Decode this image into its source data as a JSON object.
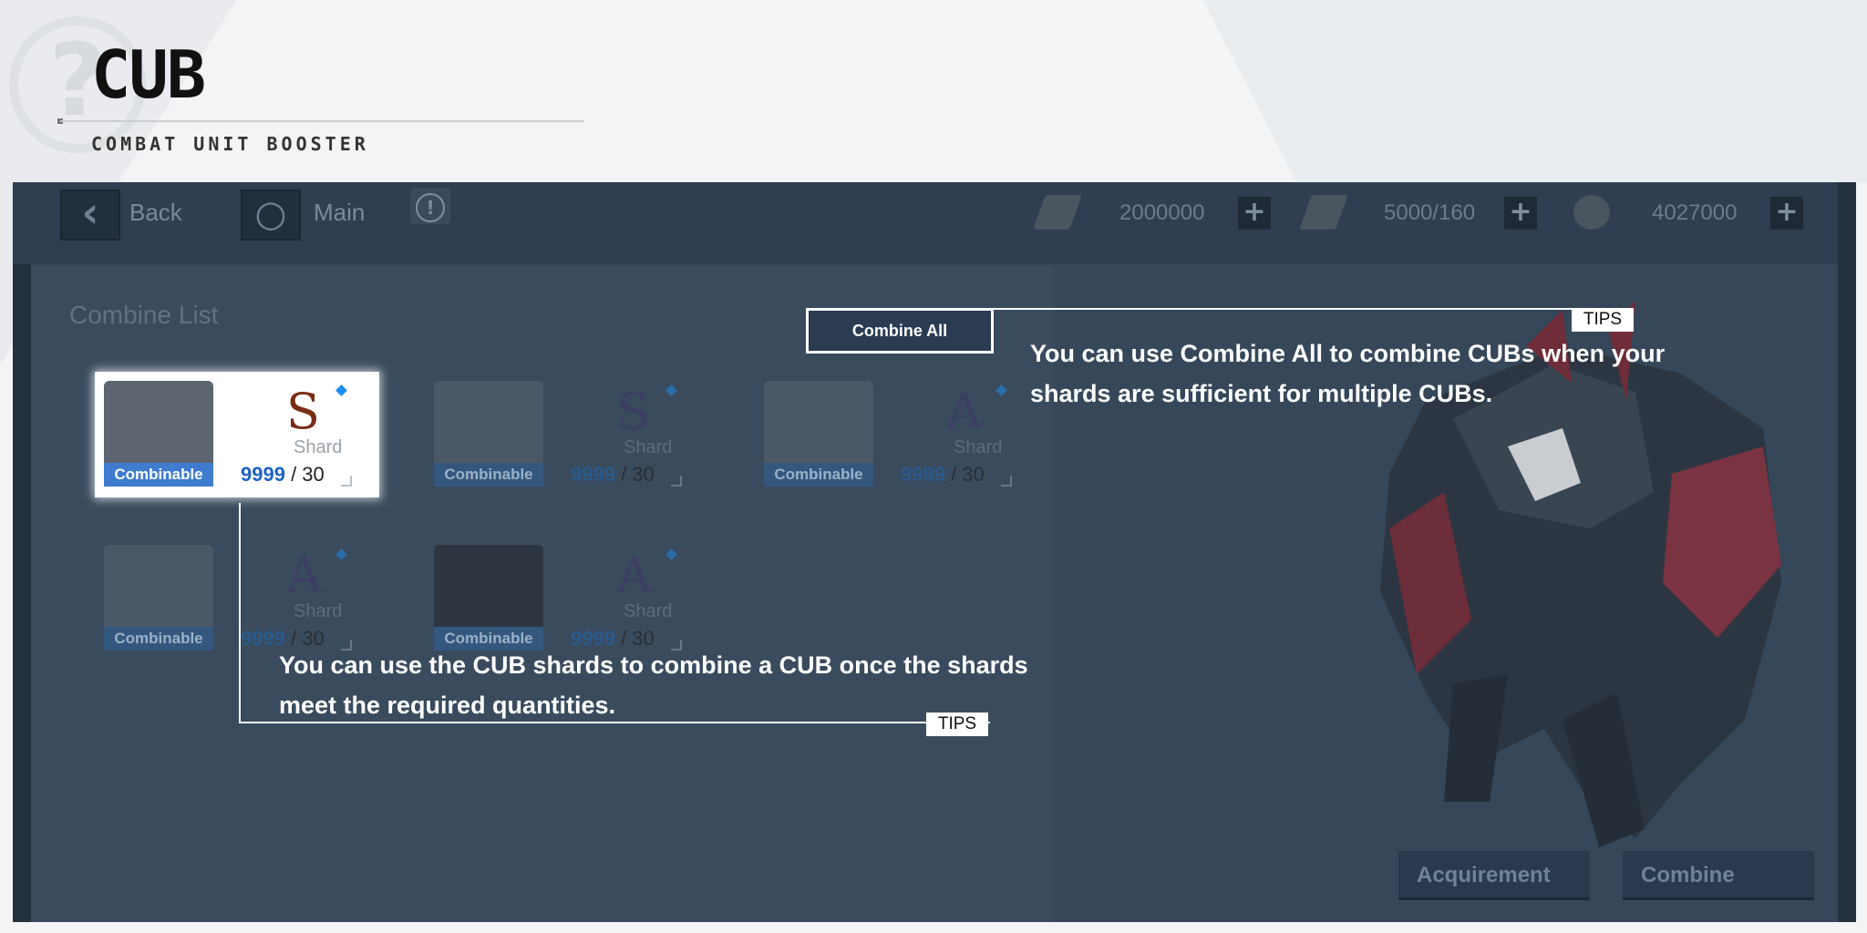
{
  "page": {
    "title": "CUB",
    "subtitle": "COMBAT UNIT BOOSTER",
    "watermark": "?"
  },
  "topbar": {
    "back_label": "Back",
    "main_label": "Main",
    "back_icon": "‹",
    "main_icon": "○",
    "info_icon": "!",
    "resources": [
      {
        "icon": "gold-icon",
        "value": "2000000"
      },
      {
        "icon": "stamina-icon",
        "value": "5000/160"
      },
      {
        "icon": "gear-coin-icon",
        "value": "4027000"
      }
    ],
    "plus": "+"
  },
  "combine_list": {
    "title": "Combine List",
    "cards": [
      {
        "grade": "S",
        "shard": "Shard",
        "tag": "Combinable",
        "owned": "9999",
        "required": "/ 30"
      },
      {
        "grade": "S",
        "shard": "Shard",
        "tag": "Combinable",
        "owned": "9999",
        "required": "/ 30"
      },
      {
        "grade": "A",
        "shard": "Shard",
        "tag": "Combinable",
        "owned": "9999",
        "required": "/ 30"
      },
      {
        "grade": "A",
        "shard": "Shard",
        "tag": "Combinable",
        "owned": "9999",
        "required": "/ 30"
      },
      {
        "grade": "A",
        "shard": "Shard",
        "tag": "Combinable",
        "owned": "9999",
        "required": "/ 30"
      }
    ]
  },
  "buttons": {
    "combine_all": "Combine All",
    "acquirement": "Acquirement",
    "combine": "Combine"
  },
  "tips": {
    "tag": "TIPS",
    "combine_all_text_1": "You can use Combine All to combine CUBs when your",
    "combine_all_text_2": "shards are sufficient for multiple CUBs.",
    "shards_text_1": "You can use the CUB shards to combine a CUB once the shards",
    "shards_text_2": "meet the required quantities."
  }
}
